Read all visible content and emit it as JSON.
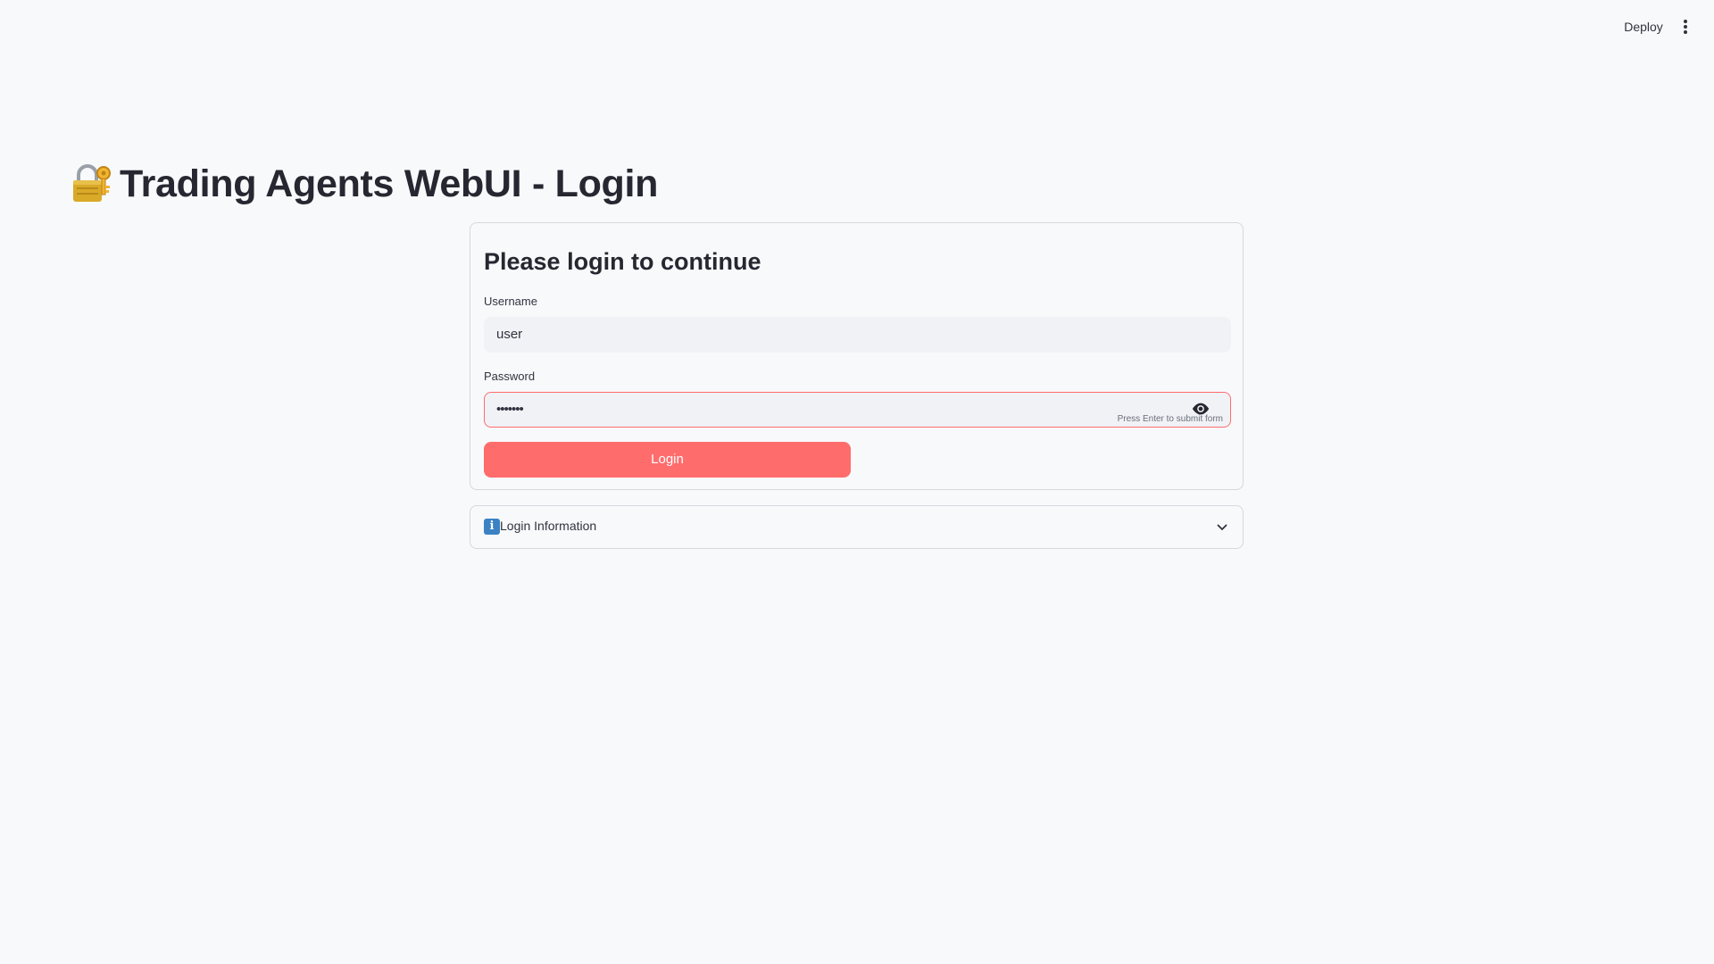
{
  "header": {
    "deploy_label": "Deploy",
    "menu_icon": "kebab-menu-icon"
  },
  "page": {
    "title_icon": "lock-with-key-icon",
    "title": "Trading Agents WebUI - Login"
  },
  "login_form": {
    "heading": "Please login to continue",
    "username_label": "Username",
    "username_value": "user",
    "password_label": "Password",
    "password_value_masked": "•••••••",
    "password_toggle_icon": "eye-icon",
    "enter_hint": "Press Enter to submit form",
    "submit_label": "Login"
  },
  "info_expander": {
    "icon": "info-icon",
    "label": "Login Information",
    "expanded": false,
    "chevron_icon": "chevron-down-icon"
  },
  "colors": {
    "background": "#f8f9fb",
    "primary": "#ff6c6c",
    "input_bg": "#f0f2f6",
    "text": "#262730",
    "border": "#d6d8dd"
  }
}
